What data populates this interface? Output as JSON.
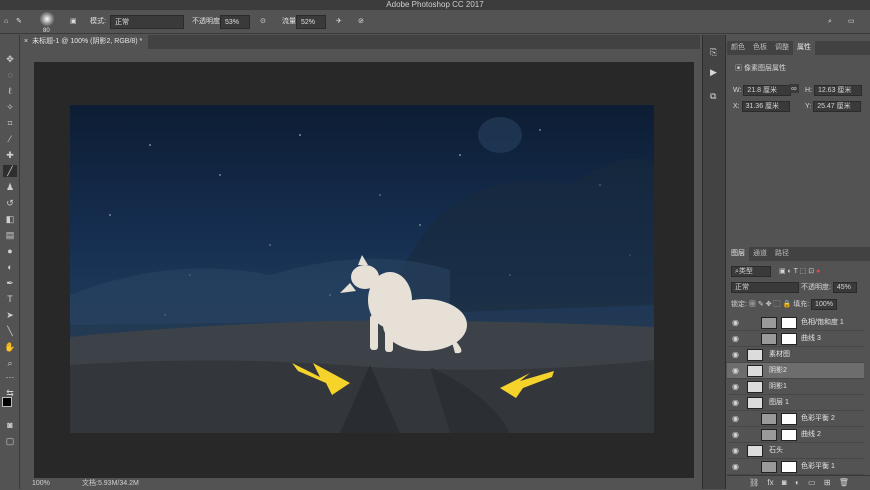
{
  "app_title": "Adobe Photoshop CC 2017",
  "options_bar": {
    "brush_size": "80",
    "mode_label": "模式:",
    "mode_value": "正常",
    "opacity_label": "不透明度:",
    "opacity_value": "53%",
    "flow_label": "流量:",
    "flow_value": "52%"
  },
  "document_tab": "未标题-1 @ 100% (阴影2, RGB/8) *",
  "status": {
    "zoom": "100%",
    "doc_size": "文档:5.93M/34.2M"
  },
  "properties_panel": {
    "tabs": [
      "颜色",
      "色板",
      "调整",
      "属性"
    ],
    "active_tab": "属性",
    "header": "像素图层属性",
    "w_label": "W:",
    "w_value": "21.8 厘米",
    "h_label": "H:",
    "h_value": "12.63 厘米",
    "x_label": "X:",
    "x_value": "31.36 厘米",
    "y_label": "Y:",
    "y_value": "25.47 厘米"
  },
  "layers_panel": {
    "tabs": [
      "图层",
      "通道",
      "路径"
    ],
    "active_tab": "图层",
    "filter_label": "类型",
    "blend_mode": "正常",
    "opacity_label": "不透明度:",
    "opacity_value": "45%",
    "lock_label": "锁定:",
    "fill_label": "填充:",
    "fill_value": "100%",
    "layers": [
      {
        "name": "色相/饱和度 1",
        "type": "adjustment",
        "selected": false
      },
      {
        "name": "曲线 3",
        "type": "adjustment",
        "selected": false
      },
      {
        "name": "素材图",
        "type": "pixel",
        "selected": false
      },
      {
        "name": "阴影2",
        "type": "pixel",
        "selected": true
      },
      {
        "name": "阴影1",
        "type": "pixel",
        "selected": false
      },
      {
        "name": "图层 1",
        "type": "pixel",
        "selected": false
      },
      {
        "name": "色彩平衡 2",
        "type": "adjustment",
        "selected": false
      },
      {
        "name": "曲线 2",
        "type": "adjustment",
        "selected": false
      },
      {
        "name": "石头",
        "type": "pixel",
        "selected": false
      },
      {
        "name": "色彩平衡 1",
        "type": "adjustment",
        "selected": false
      }
    ]
  },
  "colors": {
    "arrow": "#f5d32a",
    "wolf": "#e6e0d6"
  }
}
